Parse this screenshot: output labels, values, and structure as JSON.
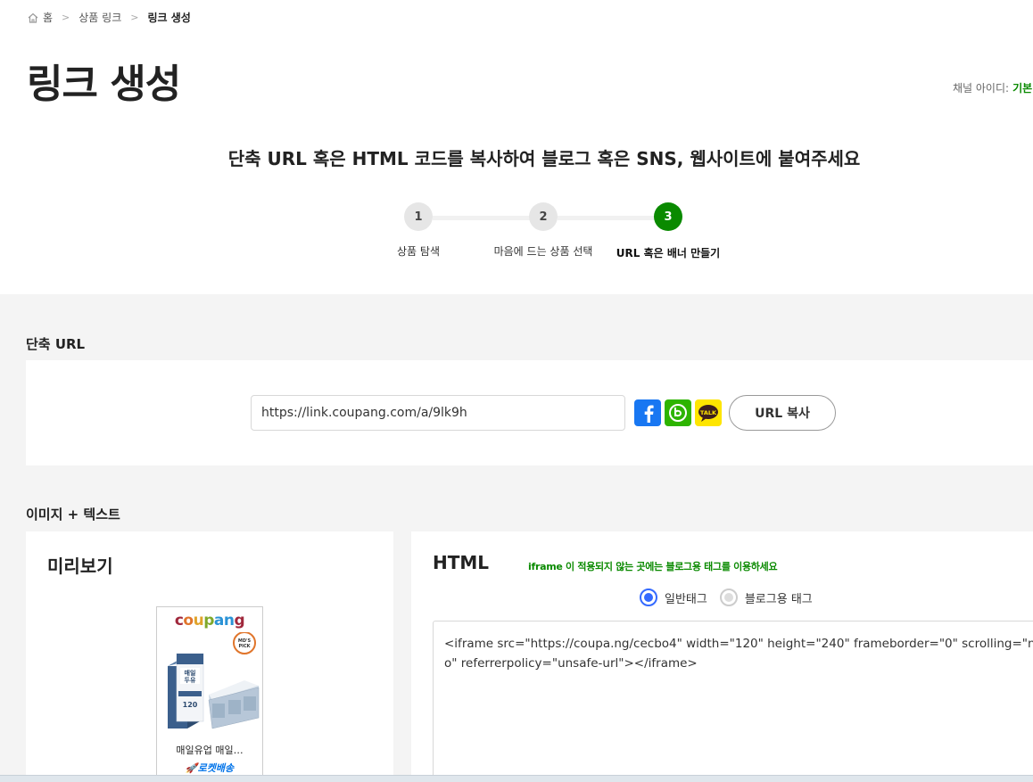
{
  "breadcrumb": {
    "home": "홈",
    "parent": "상품 링크",
    "current": "링크 생성"
  },
  "page_title": "링크 생성",
  "channel": {
    "label": "채널 아이디:",
    "value": "기본"
  },
  "headline": "단축 URL 혹은 HTML 코드를 복사하여 블로그 혹은 SNS, 웹사이트에 붙여주세요",
  "steps": [
    {
      "num": "1",
      "label": "상품 탐색"
    },
    {
      "num": "2",
      "label": "마음에 드는 상품 선택"
    },
    {
      "num": "3",
      "label": "URL 혹은 배너 만들기"
    }
  ],
  "short_url": {
    "title": "단축 URL",
    "value": "https://link.coupang.com/a/9lk9h",
    "copy_label": "URL 복사",
    "kakao_label": "TALK"
  },
  "image_text": {
    "title": "이미지 + 텍스트",
    "preview_title": "미리보기",
    "banner": {
      "logo": "coupang",
      "badge": "MD'S PICK",
      "product_name": "매일유업 매일…",
      "rocket": "로켓배송"
    },
    "html_title": "HTML",
    "html_hint": "iframe 이 적용되지 않는 곳에는 블로그용 태그를 이용하세요",
    "radio_normal": "일반태그",
    "radio_blog": "블로그용 태그",
    "code": "<iframe src=\"https://coupa.ng/cecbo4\" width=\"120\" height=\"240\" frameborder=\"0\" scrolling=\"no\" referrerpolicy=\"unsafe-url\"></iframe>"
  },
  "colors": {
    "accent_green": "#0a8a00",
    "radio_blue": "#346aff",
    "facebook": "#1877f2",
    "blog": "#2db400",
    "kakao": "#fee500"
  }
}
